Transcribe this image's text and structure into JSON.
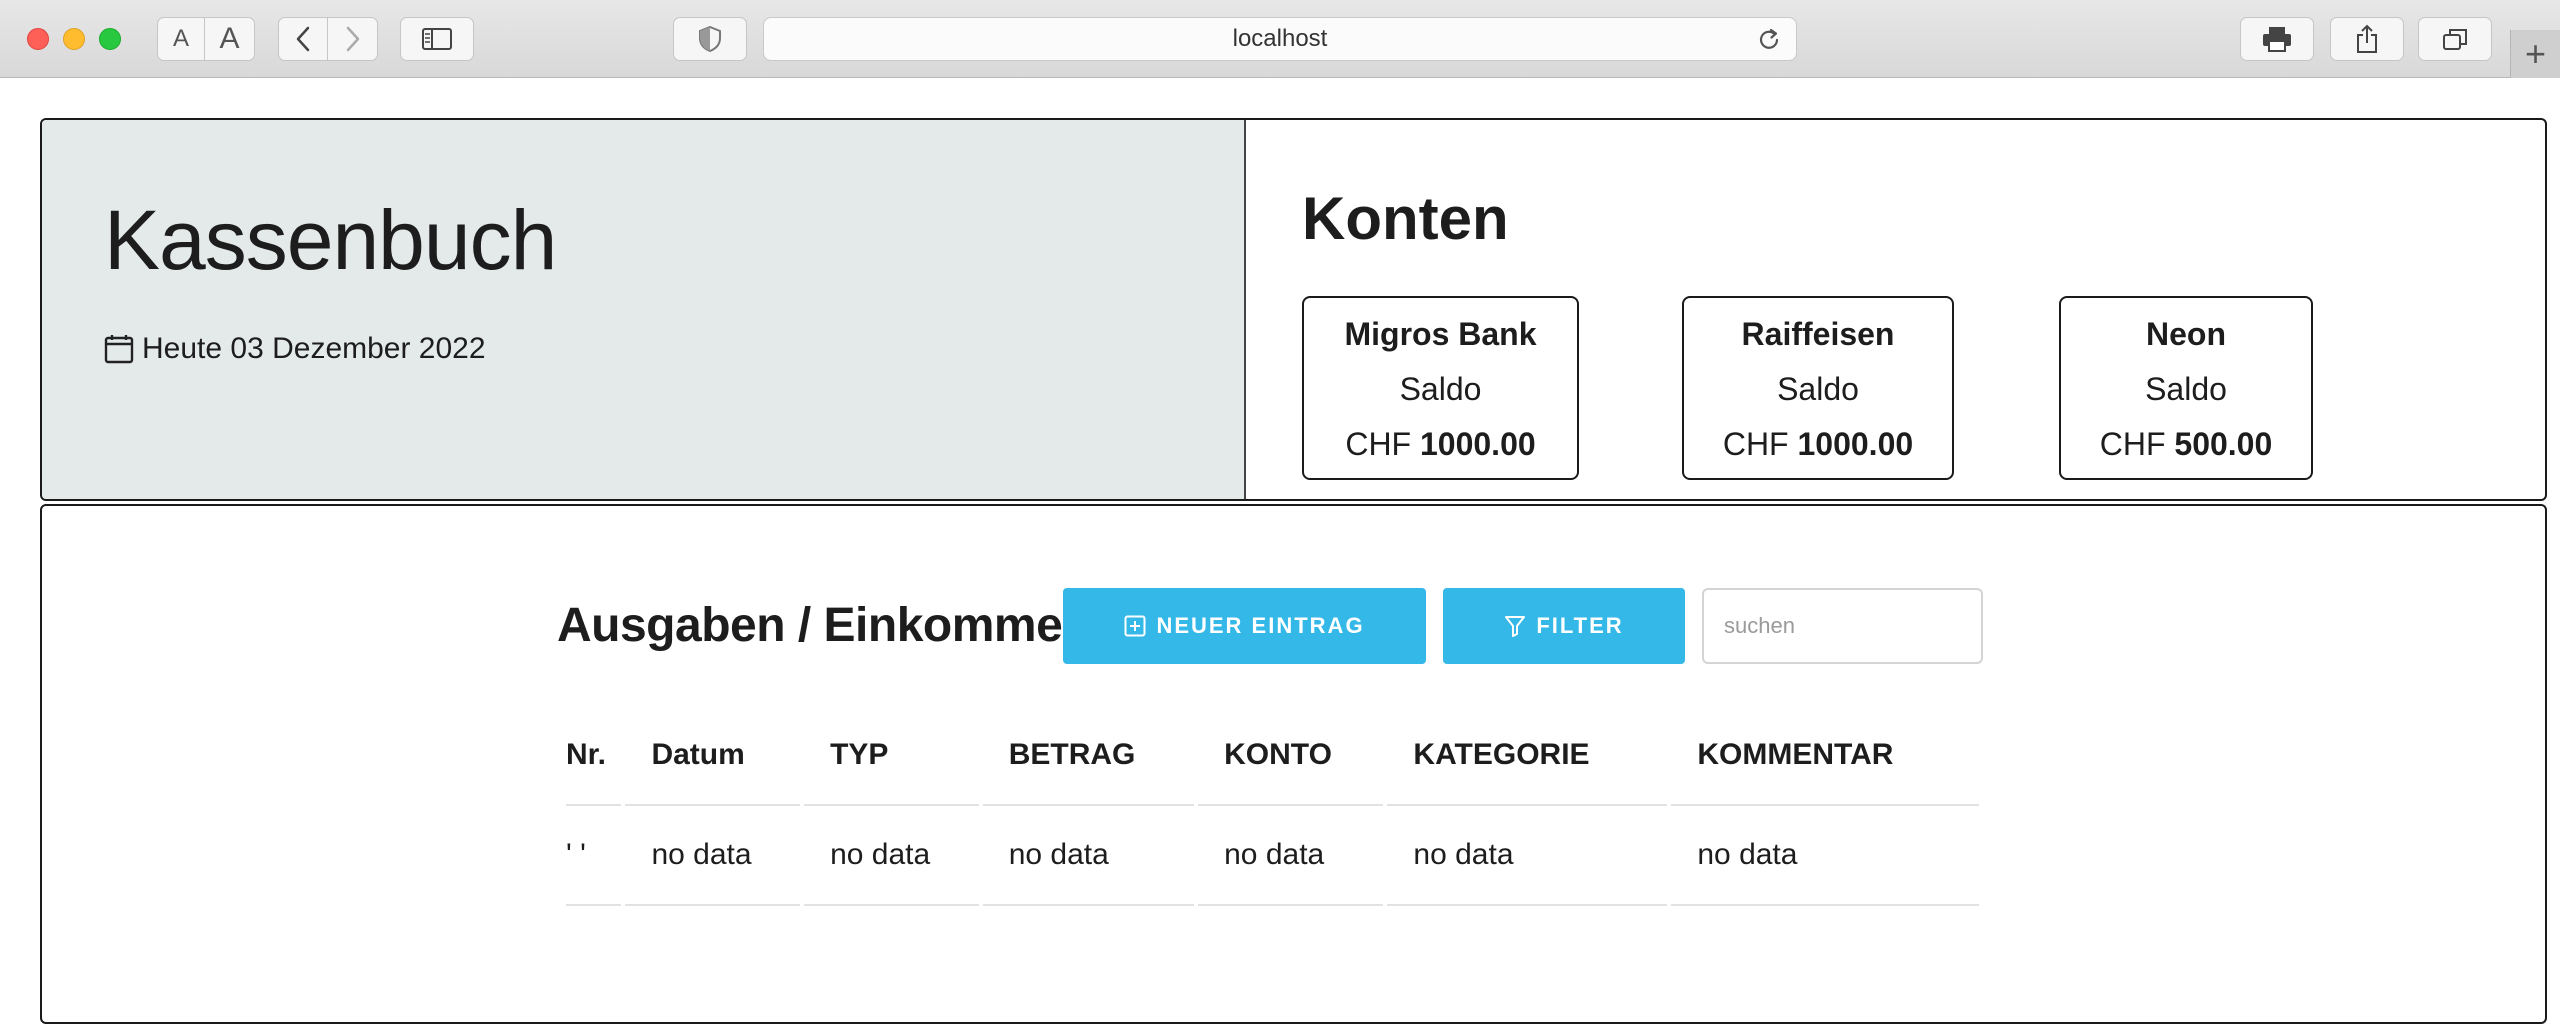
{
  "browser": {
    "url": "localhost",
    "font_small_label": "A",
    "font_large_label": "A",
    "new_tab_label": "+"
  },
  "header": {
    "title": "Kassenbuch",
    "today": "Heute 03 Dezember 2022",
    "accounts_title": "Konten",
    "accounts": [
      {
        "name": "Migros Bank",
        "saldo_label": "Saldo",
        "currency": "CHF",
        "balance": "1000.00"
      },
      {
        "name": "Raiffeisen",
        "saldo_label": "Saldo",
        "currency": "CHF",
        "balance": "1000.00"
      },
      {
        "name": "Neon",
        "saldo_label": "Saldo",
        "currency": "CHF",
        "balance": "500.00"
      }
    ]
  },
  "main": {
    "title": "Ausgaben / Einkommen",
    "new_entry_label": "NEUER EINTRAG",
    "filter_label": "FILTER",
    "search_placeholder": "suchen",
    "search_value": "",
    "table": {
      "columns": [
        "Nr.",
        "Datum",
        "TYP",
        "BETRAG",
        "KONTO",
        "KATEGORIE",
        "KOMMENTAR"
      ],
      "rows": [
        [
          "' '",
          "no data",
          "no data",
          "no data",
          "no data",
          "no data",
          "no data"
        ]
      ]
    }
  },
  "colors": {
    "accent": "#33b8e8",
    "header_bg": "#e4eaea"
  }
}
